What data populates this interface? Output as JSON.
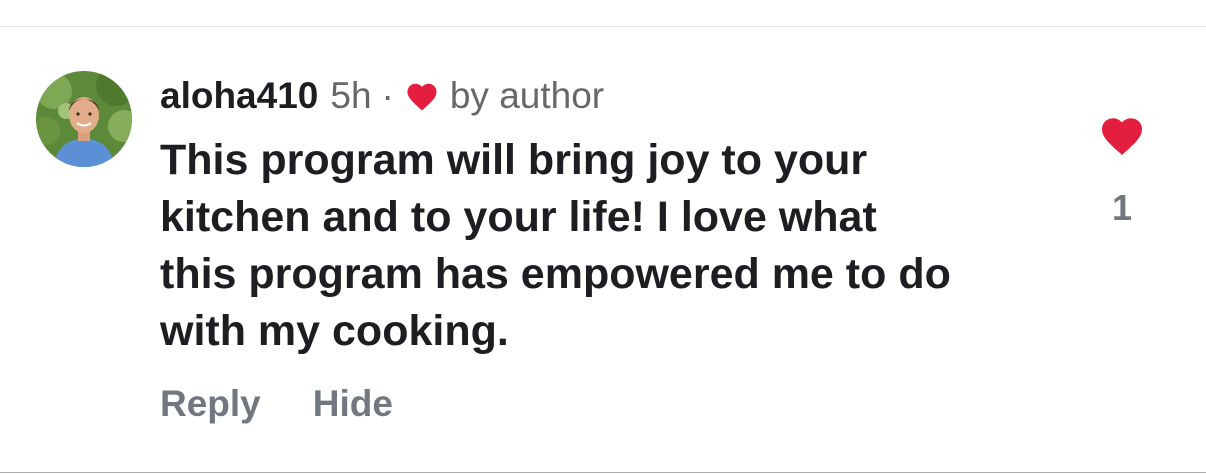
{
  "comment": {
    "author": {
      "username": "aloha410",
      "avatar_icon": "user-avatar-photo"
    },
    "timestamp": "5h",
    "separator": "·",
    "author_like": {
      "icon": "heart-icon",
      "label": "by author",
      "color": "#e41e3f"
    },
    "text": "This program will bring joy to your\nkitchen and to your life! I love what\nthis program has empowered me to do\nwith my cooking.",
    "actions": {
      "reply_label": "Reply",
      "hide_label": "Hide"
    },
    "likes": {
      "icon": "heart-icon",
      "count": "1",
      "color": "#e41e3f"
    }
  }
}
